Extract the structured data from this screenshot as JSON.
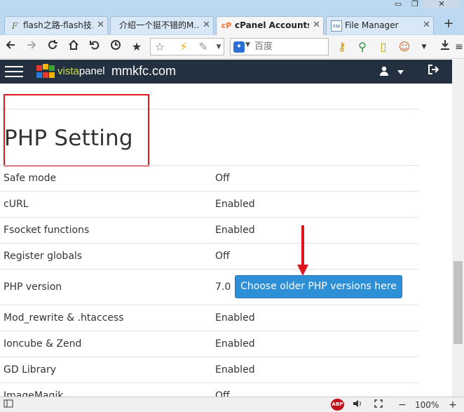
{
  "browser": {
    "tabs": [
      {
        "label": "flash之路-flash技…",
        "icon": "F"
      },
      {
        "label": "介绍一个挺不错的M…",
        "icon": ""
      },
      {
        "label": "cPanel Accounts…",
        "icon": "cP"
      },
      {
        "label": "File Manager",
        "icon": "FM"
      }
    ],
    "tab_close": "✕",
    "new_tab": "+",
    "window_controls": {
      "minimize": "▭",
      "restore": "❐",
      "close": "✕"
    },
    "search_placeholder": "百度",
    "zoom": "100%",
    "adblock_label": "ABP"
  },
  "header": {
    "brand_prefix": "vista",
    "brand_suffix": "panel",
    "domain": "mmkfc.com"
  },
  "main": {
    "title": "PHP Setting",
    "settings": [
      {
        "key": "Safe mode",
        "value": "Off"
      },
      {
        "key": "cURL",
        "value": "Enabled"
      },
      {
        "key": "Fsocket functions",
        "value": "Enabled"
      },
      {
        "key": "Register globals",
        "value": "Off"
      },
      {
        "key": "PHP version",
        "value": "7.0"
      },
      {
        "key": "Mod_rewrite & .htaccess",
        "value": "Enabled"
      },
      {
        "key": "Ioncube & Zend",
        "value": "Enabled"
      },
      {
        "key": "GD Library",
        "value": "Enabled"
      },
      {
        "key": "ImageMagik",
        "value": "Off"
      }
    ],
    "older_php_button": "Choose older PHP versions here"
  },
  "colors": {
    "header_bg": "#23303f",
    "button_bg": "#2d8fd5",
    "annotation_red": "#e0161d"
  }
}
